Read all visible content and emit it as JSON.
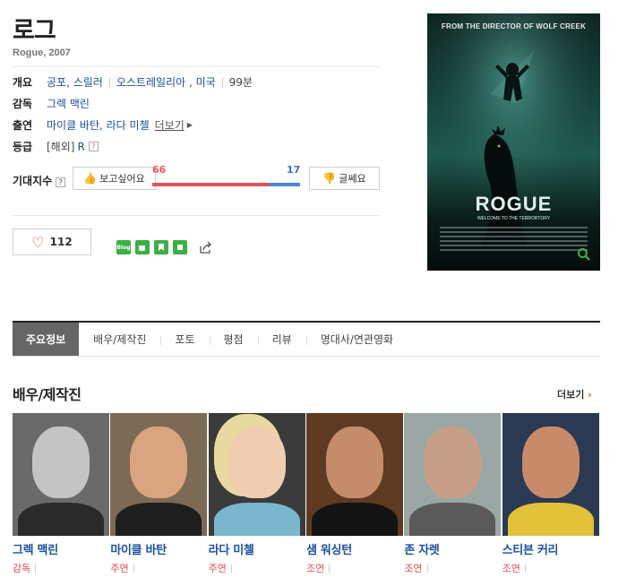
{
  "movie": {
    "title": "로그",
    "subtitle": "Rogue, 2007"
  },
  "info": {
    "overview_label": "개요",
    "genre": "공포, 스릴러",
    "country": "오스트레일리아 , 미국",
    "runtime": "99분",
    "director_label": "감독",
    "director": "그렉 맥린",
    "cast_label": "출연",
    "cast": "마이클 바탄, 라다 미첼",
    "cast_more": "더보기",
    "rating_label": "등급",
    "rating_region": "[해외]",
    "rating": "R",
    "help_mark": "?"
  },
  "expectation": {
    "label": "기대지수",
    "want_label": "보고싶어요",
    "meh_label": "글쎄요",
    "want_count": "66",
    "meh_count": "17",
    "want_fraction": 0.7952
  },
  "like": {
    "count": "112"
  },
  "share": {
    "icons": [
      "blog-icon",
      "cafe-icon",
      "bookmark-icon",
      "me-icon",
      "share-icon"
    ],
    "blog_text": "Blog"
  },
  "poster": {
    "top_text": "FROM THE DIRECTOR OF WOLF CREEK",
    "title_text": "ROGUE",
    "tagline": "WELCOME TO THE TERRORTORY"
  },
  "tabs": [
    "주요정보",
    "배우/제작진",
    "포토",
    "평점",
    "리뷰",
    "명대사/연관영화"
  ],
  "section": {
    "title": "배우/제작진",
    "more": "더보기"
  },
  "people": [
    {
      "name": "그렉 맥린",
      "role": "감독"
    },
    {
      "name": "마이클 바탄",
      "role": "주연"
    },
    {
      "name": "라다 미첼",
      "role": "주연"
    },
    {
      "name": "샘 워싱턴",
      "role": "조연"
    },
    {
      "name": "존 자렛",
      "role": "조연"
    },
    {
      "name": "스티븐 커리",
      "role": "조연"
    }
  ],
  "colors": {
    "accent_red": "#e6545a",
    "accent_blue": "#3d6fd4",
    "link_blue": "#1a4fa0",
    "naver_green": "#3cb043"
  }
}
